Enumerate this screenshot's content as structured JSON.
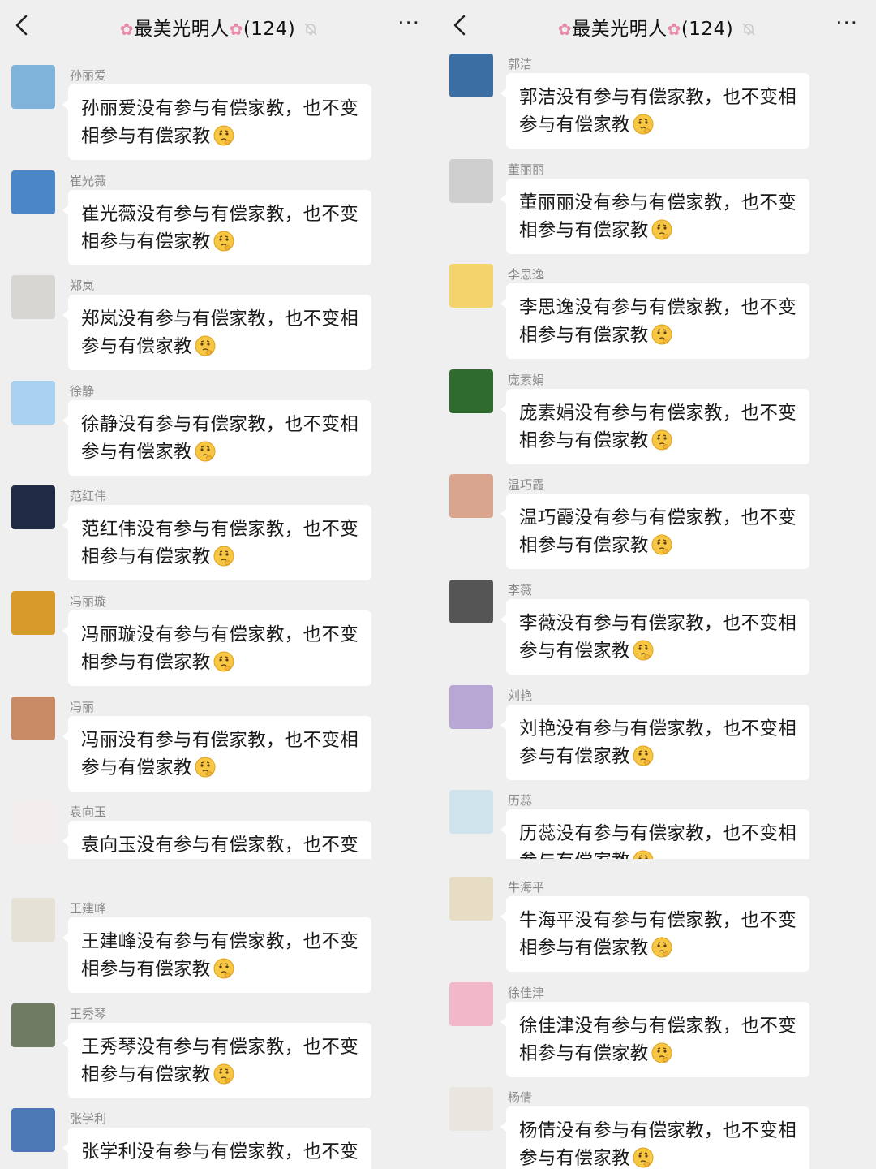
{
  "header": {
    "back_icon": "chevron-left-icon",
    "title_prefix_icon": "flower-icon",
    "title": "最美光明人",
    "count": "(124)",
    "mute_icon": "bell-off-icon",
    "more_icon": "more-dots-icon",
    "more_label": "···"
  },
  "left_top": [
    {
      "sender": "孙丽爱",
      "text": "孙丽爱没有参与有偿家教，也不变相参与有偿家教",
      "avatar": "sky-avatar",
      "color": "#7fb3da"
    },
    {
      "sender": "崔光薇",
      "text": "崔光薇没有参与有偿家教，也不变相参与有偿家教",
      "avatar": "cloud-avatar",
      "color": "#4b86c7"
    },
    {
      "sender": "郑岚",
      "text": "郑岚没有参与有偿家教，也不变相参与有偿家教",
      "avatar": "figure-avatar",
      "color": "#d8d6d2"
    },
    {
      "sender": "徐静",
      "text": "徐静没有参与有偿家教，也不变相参与有偿家教",
      "avatar": "cartoon-avatar",
      "color": "#a9d1f0"
    },
    {
      "sender": "范红伟",
      "text": "范红伟没有参与有偿家教，也不变相参与有偿家教",
      "avatar": "medal-avatar",
      "color": "#1f2a44"
    },
    {
      "sender": "冯丽璇",
      "text": "冯丽璇没有参与有偿家教，也不变相参与有偿家教",
      "avatar": "sunset-field-avatar",
      "color": "#d89a2a"
    },
    {
      "sender": "冯丽",
      "text": "冯丽没有参与有偿家教，也不变相参与有偿家教",
      "avatar": "sunset-sea-avatar",
      "color": "#c98a66"
    },
    {
      "sender": "袁向玉",
      "text": "袁向玉没有参与有偿家教，也不变",
      "avatar": "kids-avatar",
      "color": "#f3eded"
    }
  ],
  "left_bottom": [
    {
      "sender": "王建峰",
      "text": "王建峰没有参与有偿家教，也不变相参与有偿家教",
      "avatar": "sketch-avatar",
      "color": "#e6e1d6"
    },
    {
      "sender": "王秀琴",
      "text": "王秀琴没有参与有偿家教，也不变相参与有偿家教",
      "avatar": "outdoor-avatar",
      "color": "#6f7c63"
    },
    {
      "sender": "张学利",
      "text": "张学利没有参与有偿家教，也不变",
      "avatar": "beach-avatar",
      "color": "#4c78b5"
    }
  ],
  "right_top": [
    {
      "sender": "郭洁",
      "text": "郭洁没有参与有偿家教，也不变相参与有偿家教",
      "avatar": "scenery-avatar",
      "color": "#3b6fa3"
    },
    {
      "sender": "董丽丽",
      "text": "董丽丽没有参与有偿家教，也不变相参与有偿家教",
      "avatar": "portrait-avatar",
      "color": "#cfcfcf"
    },
    {
      "sender": "李思逸",
      "text": "李思逸没有参与有偿家教，也不变相参与有偿家教",
      "avatar": "baby-avatar",
      "color": "#f4d36a"
    },
    {
      "sender": "庞素娟",
      "text": "庞素娟没有参与有偿家教，也不变相参与有偿家教",
      "avatar": "lotus-avatar",
      "color": "#2f6b2f"
    },
    {
      "sender": "温巧霞",
      "text": "温巧霞没有参与有偿家教，也不变相参与有偿家教",
      "avatar": "child-avatar",
      "color": "#d9a58e"
    },
    {
      "sender": "李薇",
      "text": "李薇没有参与有偿家教，也不变相参与有偿家教",
      "avatar": "hands-avatar",
      "color": "#555555"
    },
    {
      "sender": "刘艳",
      "text": "刘艳没有参与有偿家教，也不变相参与有偿家教",
      "avatar": "lavender-avatar",
      "color": "#b8a7d4"
    },
    {
      "sender": "历蕊",
      "text": "历蕊没有参与有偿家教，也不变相参与有偿家教",
      "avatar": "bottle-avatar",
      "color": "#cfe3ec"
    }
  ],
  "right_bottom": [
    {
      "sender": "牛海平",
      "text": "牛海平没有参与有偿家教，也不变相参与有偿家教",
      "avatar": "toddler-avatar",
      "color": "#e7dcc4"
    },
    {
      "sender": "徐佳津",
      "text": "徐佳津没有参与有偿家教，也不变相参与有偿家教",
      "avatar": "cartoon-girl-avatar",
      "color": "#f0b8c8"
    },
    {
      "sender": "杨倩",
      "text": "杨倩没有参与有偿家教，也不变相参与有偿家教",
      "avatar": "woman-avatar",
      "color": "#e9e6e0"
    }
  ],
  "emoji": "thinking-face-emoji"
}
